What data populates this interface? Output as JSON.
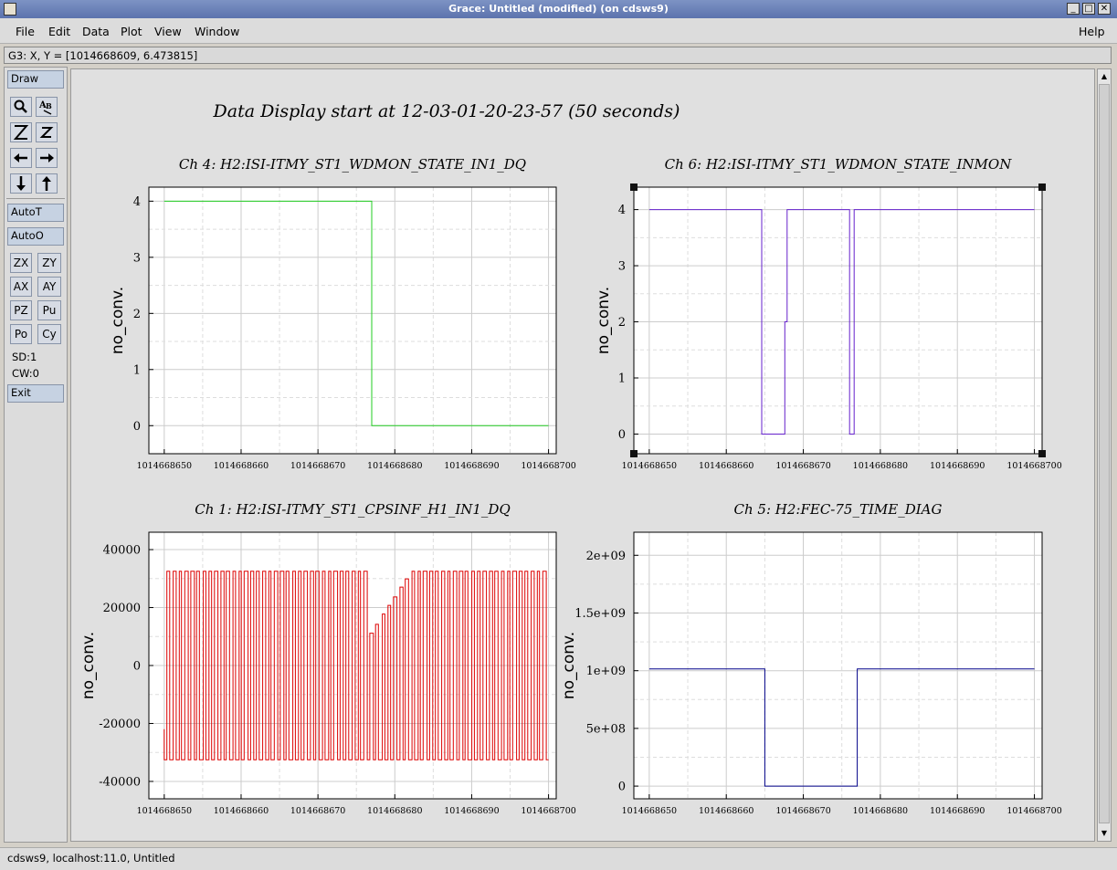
{
  "window": {
    "title": "Grace: Untitled (modified) (on cdsws9)"
  },
  "menu": [
    "File",
    "Edit",
    "Data",
    "Plot",
    "View",
    "Window"
  ],
  "help_label": "Help",
  "coord_readout": "G3: X, Y = [1014668609, 6.473815]",
  "tools": {
    "draw": "Draw",
    "autot": "AutoT",
    "autoo": "AutoO",
    "zx": "ZX",
    "zy": "ZY",
    "ax": "AX",
    "ay": "AY",
    "pz": "PZ",
    "pu": "Pu",
    "po": "Po",
    "cy": "Cy",
    "sd": "SD:1",
    "cw": "CW:0",
    "exit": "Exit"
  },
  "status": "cdsws9, localhost:11.0, Untitled",
  "plot_title": "Data Display start at 12-03-01-20-23-57 (50 seconds)",
  "chart_data": [
    {
      "type": "line",
      "title": "Ch 4: H2:ISI-ITMY_ST1_WDMON_STATE_IN1_DQ",
      "ylabel": "no_conv.",
      "color": "#22cc22",
      "xlim": [
        1014668648,
        1014668701
      ],
      "ylim": [
        -0.5,
        4.25
      ],
      "xticks": [
        "1014668650",
        "1014668660",
        "1014668670",
        "1014668680",
        "1014668690",
        "1014668700"
      ],
      "yticks": [
        "0",
        "1",
        "2",
        "3",
        "4"
      ],
      "series": [
        {
          "x": [
            1014668650,
            1014668677,
            1014668677,
            1014668700
          ],
          "y": [
            4,
            4,
            0,
            0
          ]
        }
      ]
    },
    {
      "type": "line",
      "title": "Ch 6: H2:ISI-ITMY_ST1_WDMON_STATE_INMON",
      "ylabel": "no_conv.",
      "color": "#6622cc",
      "xlim": [
        1014668648,
        1014668701
      ],
      "ylim": [
        -0.35,
        4.4
      ],
      "xticks": [
        "1014668650",
        "1014668660",
        "1014668670",
        "1014668680",
        "1014668690",
        "1014668700"
      ],
      "yticks": [
        "0",
        "1",
        "2",
        "3",
        "4"
      ],
      "series": [
        {
          "x": [
            1014668650,
            1014668664.6,
            1014668664.6,
            1014668667.6,
            1014668667.6,
            1014668667.9,
            1014668667.9,
            1014668676,
            1014668676,
            1014668676.6,
            1014668676.6,
            1014668700
          ],
          "y": [
            4,
            4,
            0,
            0,
            2,
            2,
            4,
            4,
            0,
            0,
            4,
            4
          ]
        }
      ]
    },
    {
      "type": "line",
      "title": "Ch 1: H2:ISI-ITMY_ST1_CPSINF_H1_IN1_DQ",
      "ylabel": "no_conv.",
      "color": "#dd0000",
      "xlim": [
        1014668648,
        1014668701
      ],
      "ylim": [
        -46000,
        46000
      ],
      "xticks": [
        "1014668650",
        "1014668660",
        "1014668670",
        "1014668680",
        "1014668690",
        "1014668700"
      ],
      "yticks": [
        "-40000",
        "-20000",
        "0",
        "20000",
        "40000"
      ],
      "series": [
        {
          "x_start": 1014668650,
          "x_end": 1014668700,
          "amplitude": 32500,
          "style": "square-wave oscillation"
        }
      ]
    },
    {
      "type": "line",
      "title": "Ch 5: H2:FEC-75_TIME_DIAG",
      "ylabel": "no_conv.",
      "color": "#000088",
      "xlim": [
        1014668648,
        1014668701
      ],
      "ylim": [
        -110000000.0,
        2200000000.0
      ],
      "xticks": [
        "1014668650",
        "1014668660",
        "1014668670",
        "1014668680",
        "1014668690",
        "1014668700"
      ],
      "yticks": [
        "0",
        "5e+08",
        "1e+09",
        "1.5e+09",
        "2e+09"
      ],
      "series": [
        {
          "x": [
            1014668650,
            1014668665,
            1014668665,
            1014668677,
            1014668677,
            1014668700
          ],
          "y": [
            1014668650,
            1014668650,
            0,
            0,
            1014668677,
            1014668700
          ]
        }
      ]
    }
  ]
}
